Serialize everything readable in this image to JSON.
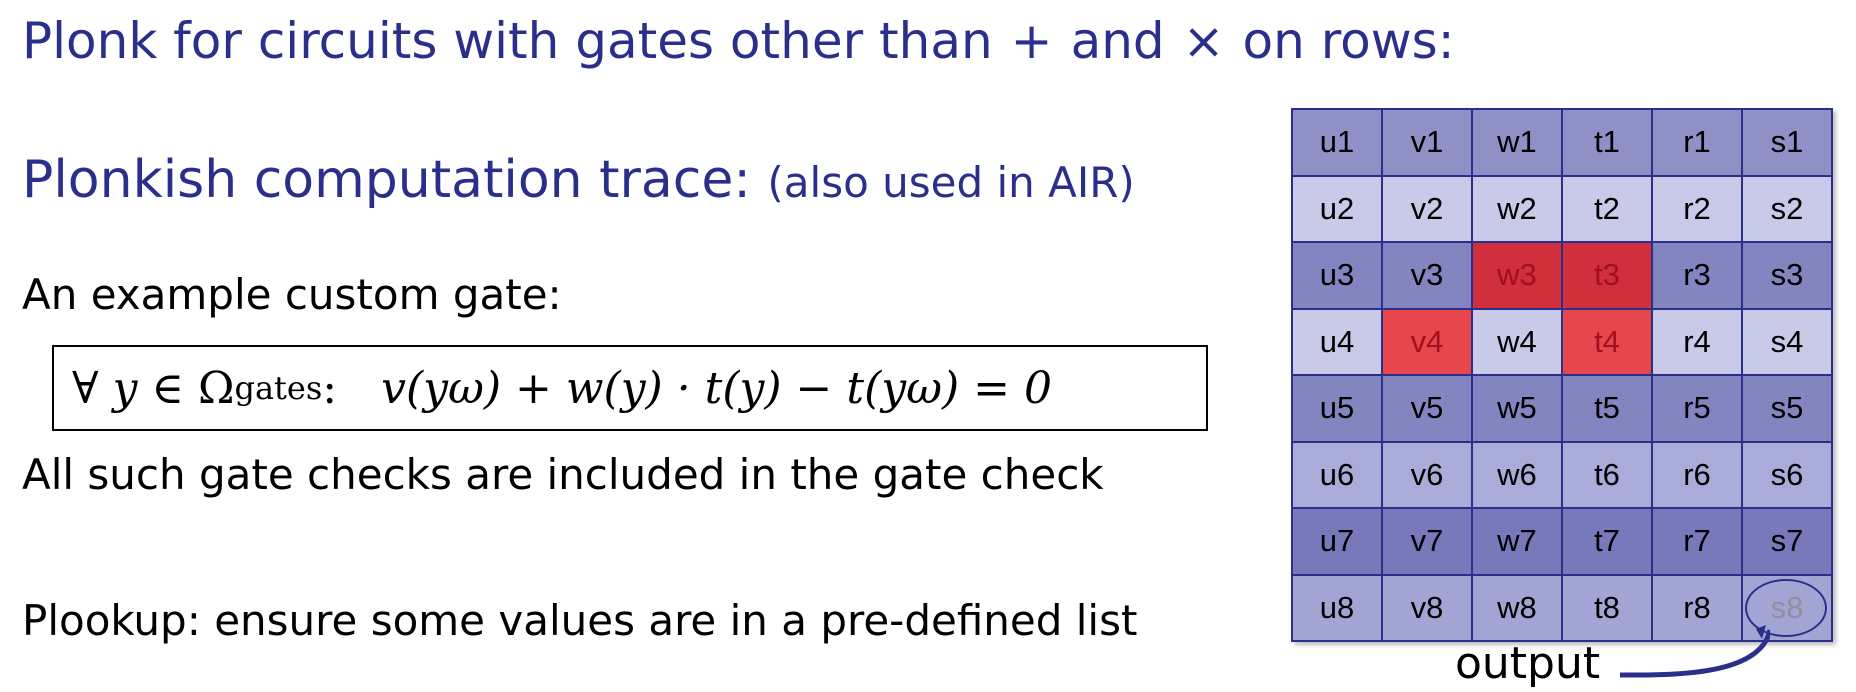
{
  "title": {
    "before": "Plonk for circuits with gates other than",
    "plus": "+",
    "and": "and",
    "times": "×",
    "after": "on rows:"
  },
  "subtitle": {
    "text": "Plonkish computation trace:",
    "note": "(also used in AIR)"
  },
  "example_label": "An example custom gate:",
  "formula": {
    "forall": "∀",
    "var": "y",
    "in": "∈",
    "omega": "Ω",
    "sub": "gates",
    "colon": ":",
    "expression": "v(yω) + w(y) · t(y) − t(yω) = 0"
  },
  "gate_check_text": "All such gate checks are included in the gate check",
  "plookup_text": "Plookup:  ensure some values are in a pre-defined list",
  "trace_table": {
    "rows": [
      [
        "u1",
        "v1",
        "w1",
        "t1",
        "r1",
        "s1"
      ],
      [
        "u2",
        "v2",
        "w2",
        "t2",
        "r2",
        "s2"
      ],
      [
        "u3",
        "v3",
        "w3",
        "t3",
        "r3",
        "s3"
      ],
      [
        "u4",
        "v4",
        "w4",
        "t4",
        "r4",
        "s4"
      ],
      [
        "u5",
        "v5",
        "w5",
        "t5",
        "r5",
        "s5"
      ],
      [
        "u6",
        "v6",
        "w6",
        "t6",
        "r6",
        "s6"
      ],
      [
        "u7",
        "v7",
        "w7",
        "t7",
        "r7",
        "s7"
      ],
      [
        "u8",
        "v8",
        "w8",
        "t8",
        "r8",
        "s8"
      ]
    ],
    "highlighted_cells": [
      "w3",
      "t3",
      "v4",
      "t4"
    ],
    "output_cell": "s8",
    "colors": {
      "border": "#2b2f8c",
      "row_dark": "#8e90c6",
      "row_light": "#c9cae7",
      "highlight": "#e8464d"
    }
  },
  "output_label": "output",
  "output_arrow_icon": "curved-arrow-icon",
  "accent_color": "#2b2f8c"
}
